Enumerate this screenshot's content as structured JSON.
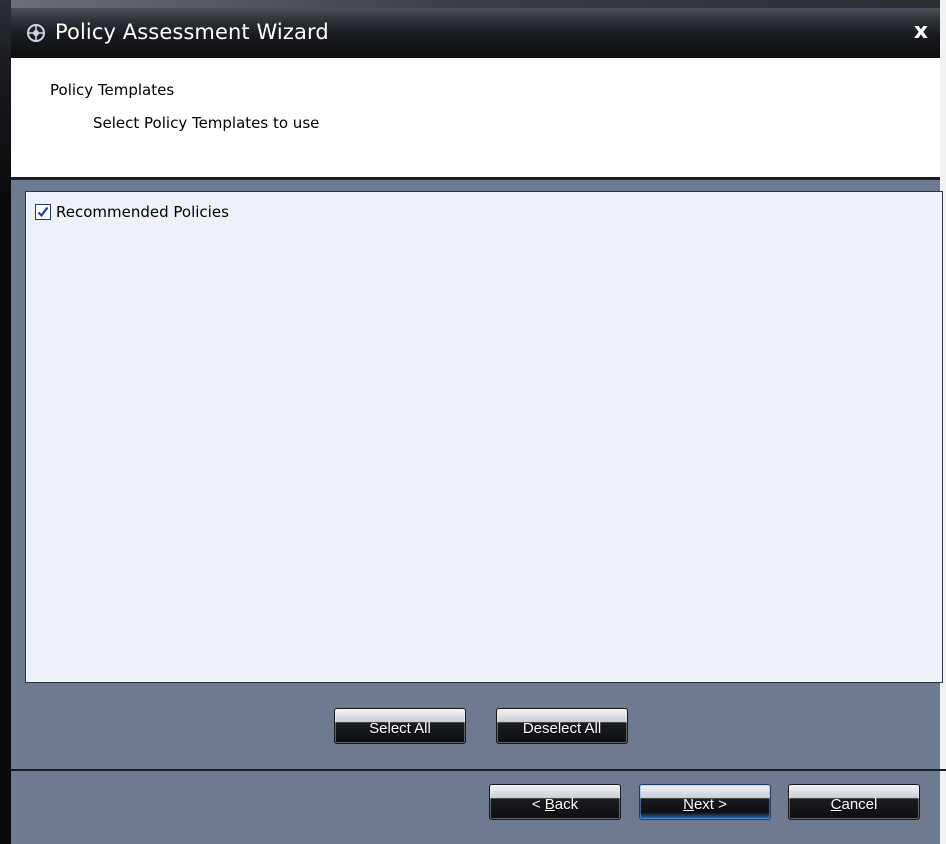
{
  "window": {
    "title": "Policy Assessment Wizard",
    "close_label": "x"
  },
  "header": {
    "title": "Policy Templates",
    "subtitle": "Select Policy Templates to use"
  },
  "policy_list": {
    "items": [
      {
        "label": "Recommended Policies",
        "checked": true
      }
    ]
  },
  "list_actions": {
    "select_all": "Select All",
    "deselect_all": "Deselect All"
  },
  "nav": {
    "back_prefix": "< ",
    "back_mnemonic": "B",
    "back_rest": "ack",
    "next_mnemonic": "N",
    "next_rest": "ext >",
    "cancel_mnemonic": "C",
    "cancel_rest": "ancel"
  },
  "colors": {
    "panel_bg": "#eef1fa",
    "dialog_bg": "#6e7a90",
    "title_bar": "#181a1d",
    "primary_glow": "#2a6fb8"
  }
}
